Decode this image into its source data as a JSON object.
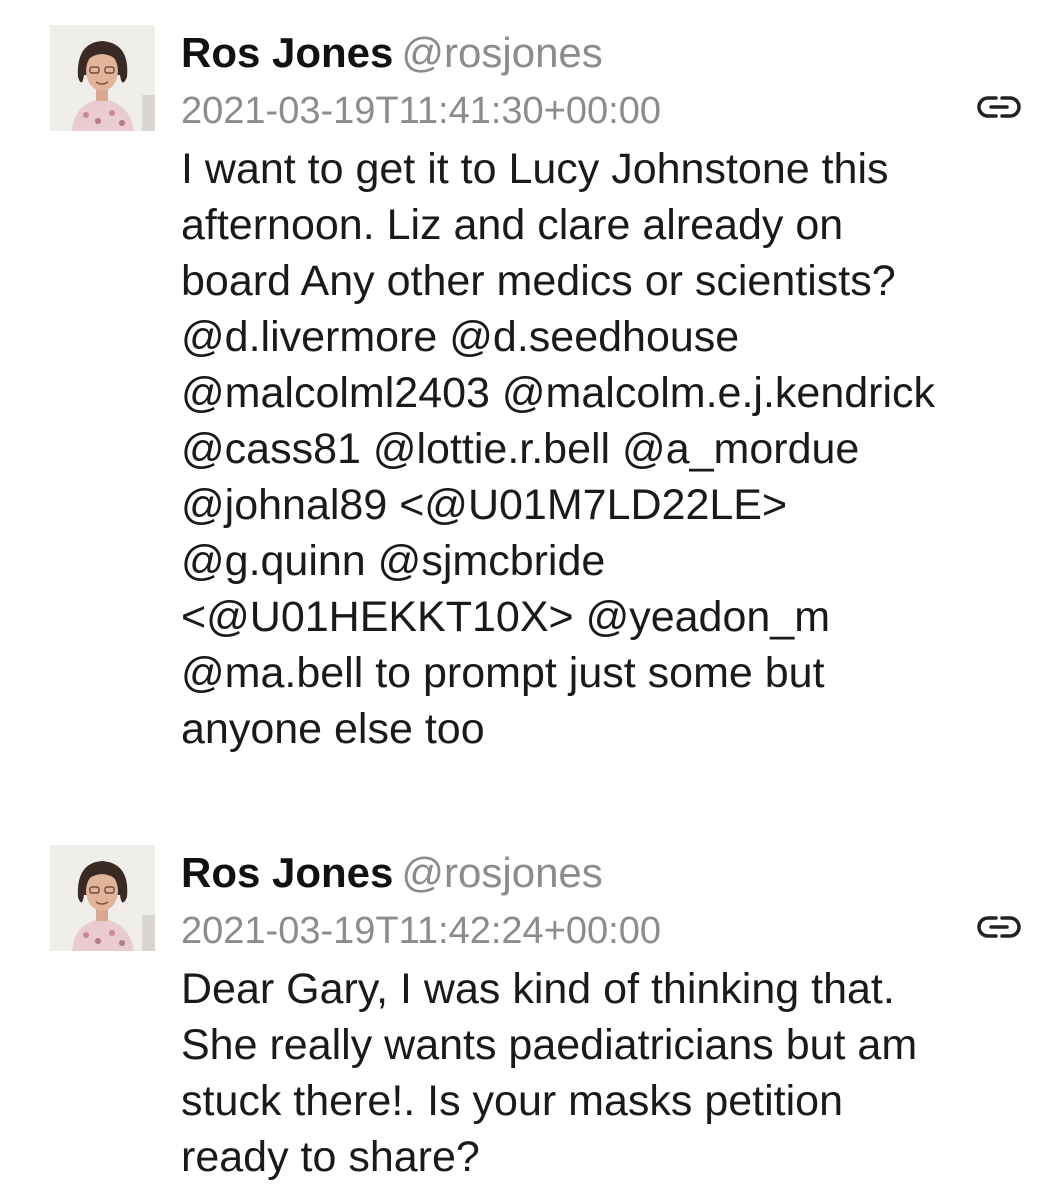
{
  "messages": [
    {
      "author": {
        "display_name": "Ros Jones",
        "handle": "@rosjones",
        "avatar_icon": "avatar-photo"
      },
      "timestamp": "2021-03-19T11:41:30+00:00",
      "link_icon": "link-icon",
      "lines": [
        "I want to get it to Lucy Johnstone this",
        "afternoon.  Liz and clare already on",
        "board  Any other medics or scientists?",
        "@d.livermore @d.seedhouse",
        "@malcolml2403 @malcolm.e.j.kendrick",
        "@cass81 @lottie.r.bell @a_mordue",
        "@johnal89 <@U01M7LD22LE>",
        "@g.quinn @sjmcbride",
        "<@U01HEKKT10X> @yeadon_m",
        "@ma.bell to prompt just some but",
        "anyone else too"
      ]
    },
    {
      "author": {
        "display_name": "Ros Jones",
        "handle": "@rosjones",
        "avatar_icon": "avatar-photo"
      },
      "timestamp": "2021-03-19T11:42:24+00:00",
      "link_icon": "link-icon",
      "lines": [
        "Dear Gary, I was kind of thinking that.",
        "She really wants paediatricians but am",
        "stuck there!. Is your masks petition",
        "ready to share?"
      ]
    }
  ],
  "colors": {
    "text": "#1a1a1a",
    "muted": "#8c8c8c",
    "background": "#ffffff"
  }
}
